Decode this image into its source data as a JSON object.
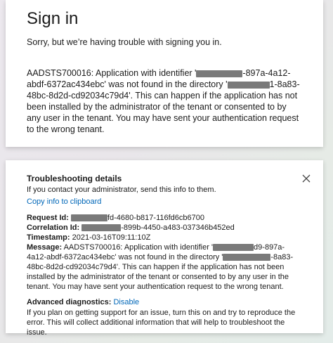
{
  "signin": {
    "title": "Sign in",
    "subtitle": "Sorry, but we’re having trouble with signing you in.",
    "error_prefix": "AADSTS700016: Application with identifier '",
    "error_id_tail": "-897a-4a12-abdf-6372ac434ebc' was not found in the directory '",
    "error_dir_tail": "1-8a83-48bc-8d2d-cd92034c79d4'. This can happen if the application has not been installed by the administrator of the tenant or consented to by any user in the tenant. You may have sent your authentication request to the wrong tenant."
  },
  "troubleshooting": {
    "title": "Troubleshooting details",
    "intro": "If you contact your administrator, send this info to them.",
    "copy_link": "Copy info to clipboard",
    "request_id_label": "Request Id:",
    "request_id_tail": "fd-4680-b817-116fd6cb6700",
    "correlation_id_label": "Correlation Id:",
    "correlation_id_tail": "-899b-4450-a483-037346b452ed",
    "timestamp_label": "Timestamp:",
    "timestamp_value": "2021-03-16T09:11:10Z",
    "message_label": "Message:",
    "message_prefix": "AADSTS700016: Application with identifier '",
    "message_id_tail": "d9-897a-4a12-abdf-6372ac434ebc' was not found in the directory '",
    "message_dir_tail": "-8a83-48bc-8d2d-cd92034c79d4'. This can happen if the application has not been installed by the administrator of the tenant or consented to by any user in the tenant. You may have sent your authentication request to the wrong tenant.",
    "diagnostics_label": "Advanced diagnostics:",
    "diagnostics_link": "Disable",
    "diagnostics_desc": "If you plan on getting support for an issue, turn this on and try to reproduce the error. This will collect additional information that will help to troubleshoot the issue."
  },
  "icons": {
    "close": "close-icon"
  },
  "colors": {
    "link": "#0067b8",
    "redaction": "#7a7a7a"
  }
}
